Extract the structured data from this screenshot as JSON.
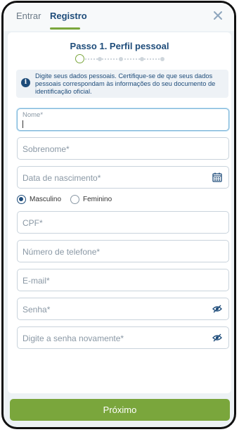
{
  "tabs": [
    {
      "label": "Entrar",
      "active": false
    },
    {
      "label": "Registro",
      "active": true
    }
  ],
  "step": {
    "title": "Passo 1. Perfil pessoal",
    "current": 1,
    "total": 5
  },
  "info": {
    "text": "Digite seus dados pessoais. Certifique-se de que seus dados pessoais correspondam às informações do seu documento de identificação oficial."
  },
  "fields": {
    "name": {
      "label": "Nome*",
      "value": ""
    },
    "surname": {
      "label": "Sobrenome*",
      "value": ""
    },
    "birthdate": {
      "label": "Data de nascimento*",
      "value": ""
    },
    "cpf": {
      "label": "CPF*",
      "value": ""
    },
    "phone": {
      "label": "Número de telefone*",
      "value": ""
    },
    "email": {
      "label": "E-mail*",
      "value": ""
    },
    "password": {
      "label": "Senha*",
      "value": ""
    },
    "password_confirm": {
      "label": "Digite a senha novamente*",
      "value": ""
    }
  },
  "gender": {
    "options": [
      {
        "label": "Masculino",
        "selected": true
      },
      {
        "label": "Feminino",
        "selected": false
      }
    ]
  },
  "next_label": "Próximo",
  "colors": {
    "primary": "#1e4c7a",
    "accent": "#7aa63c",
    "background": "#edf2f5"
  }
}
